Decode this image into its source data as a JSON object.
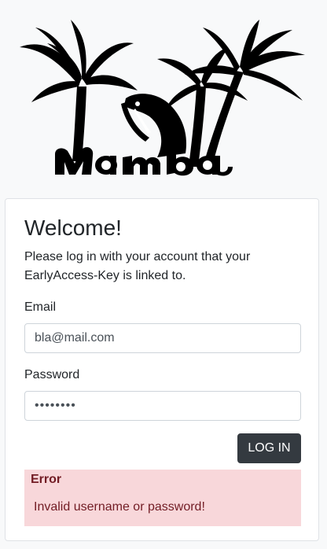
{
  "logo": {
    "brand_text": "Mamba",
    "icon": "palm-tree-snake-logo"
  },
  "login": {
    "title": "Welcome!",
    "intro": "Please log in with your account that your EarlyAccess-Key is linked to.",
    "email_label": "Email",
    "email_value": "bla@mail.com",
    "password_label": "Password",
    "password_value": "••••••••",
    "submit_label": "LOG IN"
  },
  "error": {
    "title": "Error",
    "message": "Invalid username or password!"
  },
  "colors": {
    "page_bg": "#f8f9fa",
    "button_bg": "#343a40",
    "alert_bg": "#f8d7da",
    "alert_text": "#721c24"
  }
}
